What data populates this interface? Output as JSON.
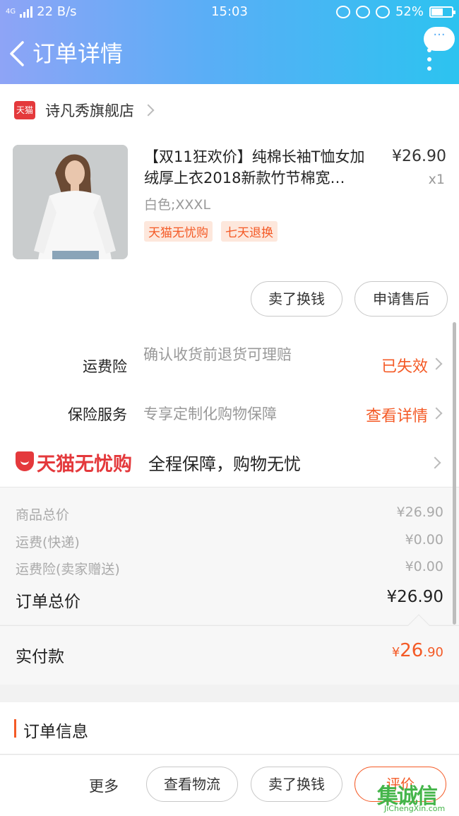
{
  "status_bar": {
    "network": "4G",
    "speed": "22 B/s",
    "time": "15:03",
    "battery": "52%"
  },
  "nav": {
    "title": "订单详情",
    "more_label": "···"
  },
  "store": {
    "badge": "天猫",
    "name": "诗凡秀旗舰店"
  },
  "product": {
    "title": "【双11狂欢价】纯棉长袖T恤女加绒厚上衣2018新款竹节棉宽…",
    "price": "¥26.90",
    "quantity": "x1",
    "sku": "白色;XXXL",
    "tags": [
      "天猫无忧购",
      "七天退换"
    ]
  },
  "product_actions": {
    "sell_label": "卖了换钱",
    "after_sale_label": "申请售后"
  },
  "freight_insurance": {
    "label": "运费险",
    "desc": "确认收货前退货可理赔",
    "status": "已失效"
  },
  "insurance_service": {
    "label": "保险服务",
    "desc": "专享定制化购物保障",
    "status": "查看详情"
  },
  "wuyou": {
    "brand": "天猫无忧购",
    "slogan": "全程保障，购物无忧"
  },
  "summary": {
    "rows": [
      {
        "label": "商品总价",
        "value": "¥26.90"
      },
      {
        "label": "运费(快递)",
        "value": "¥0.00"
      },
      {
        "label": "运费险(卖家赠送)",
        "value": "¥0.00"
      }
    ],
    "total_label": "订单总价",
    "total_value": "¥26.90"
  },
  "paid": {
    "label": "实付款",
    "currency": "¥",
    "integer": "26",
    "decimal": ".90"
  },
  "order_info": {
    "title": "订单信息"
  },
  "bottom_bar": {
    "more": "更多",
    "logistics": "查看物流",
    "sell": "卖了换钱",
    "review": "评价"
  },
  "watermark": {
    "logo": "集诚信",
    "sub": "JiChengXin.com"
  },
  "colors": {
    "accent": "#f45a26",
    "tmall_red": "#e4393c",
    "header_start": "#8ea4f6",
    "header_end": "#2cc3f0"
  }
}
